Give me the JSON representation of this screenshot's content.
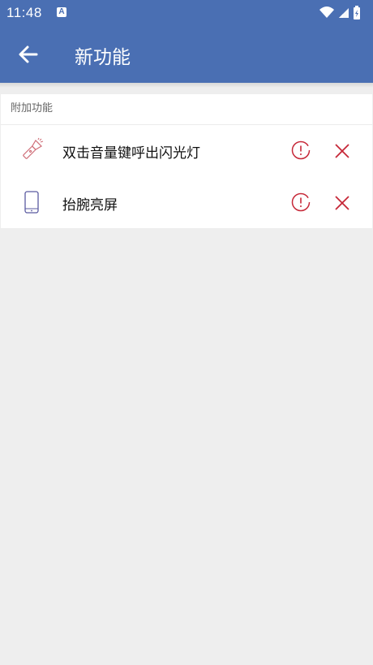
{
  "status_bar": {
    "time": "11:48",
    "notification_glyph": "A",
    "icons": [
      "wifi-icon",
      "signal-icon",
      "battery-icon"
    ]
  },
  "app_bar": {
    "title": "新功能",
    "back_icon": "arrow-left-icon",
    "color": "#4a6fb3"
  },
  "section": {
    "header": "附加功能",
    "items": [
      {
        "label": "双击音量键呼出闪光灯",
        "icon": "flashlight-icon",
        "icon_color": "#d0707a"
      },
      {
        "label": "抬腕亮屏",
        "icon": "phone-icon",
        "icon_color": "#5a5aa0"
      }
    ],
    "action_color": "#c62838"
  }
}
